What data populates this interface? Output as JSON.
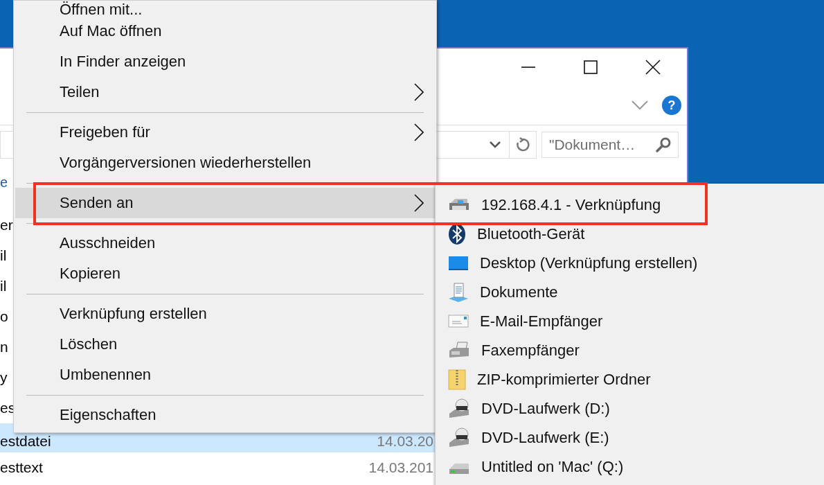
{
  "explorer_window": {
    "help_button": {
      "label": "?"
    },
    "search": {
      "placeholder": "\"Dokument…"
    },
    "nav_items": [
      {
        "label": "e"
      }
    ],
    "files": [
      {
        "name": "er",
        "selected": false
      },
      {
        "name": "il",
        "selected": false
      },
      {
        "name": "il",
        "selected": false
      },
      {
        "name": "o",
        "selected": false
      },
      {
        "name": "n",
        "selected": false
      },
      {
        "name": "y",
        "selected": false
      },
      {
        "name": "es",
        "selected": false
      },
      {
        "name": "estdatei",
        "date": "14.03.20",
        "selected": true
      },
      {
        "name": "esttext",
        "date": "14.03.201",
        "selected": false
      }
    ]
  },
  "context_menu": {
    "items": [
      {
        "kind": "item",
        "label": "Öffnen mit...",
        "has_submenu": false,
        "selected": false
      },
      {
        "kind": "item",
        "label": "Auf Mac öffnen",
        "has_submenu": false,
        "selected": false
      },
      {
        "kind": "item",
        "label": "In Finder anzeigen",
        "has_submenu": false,
        "selected": false
      },
      {
        "kind": "item",
        "label": "Teilen",
        "has_submenu": true,
        "selected": false
      },
      {
        "kind": "separator"
      },
      {
        "kind": "item",
        "label": "Freigeben für",
        "has_submenu": true,
        "selected": false
      },
      {
        "kind": "item",
        "label": "Vorgängerversionen wiederherstellen",
        "has_submenu": false,
        "selected": false
      },
      {
        "kind": "separator"
      },
      {
        "kind": "item",
        "label": "Senden an",
        "has_submenu": true,
        "selected": true
      },
      {
        "kind": "separator"
      },
      {
        "kind": "item",
        "label": "Ausschneiden",
        "has_submenu": false,
        "selected": false
      },
      {
        "kind": "item",
        "label": "Kopieren",
        "has_submenu": false,
        "selected": false
      },
      {
        "kind": "separator"
      },
      {
        "kind": "item",
        "label": "Verknüpfung erstellen",
        "has_submenu": false,
        "selected": false
      },
      {
        "kind": "item",
        "label": "Löschen",
        "has_submenu": false,
        "selected": false
      },
      {
        "kind": "item",
        "label": "Umbenennen",
        "has_submenu": false,
        "selected": false
      },
      {
        "kind": "separator"
      },
      {
        "kind": "item",
        "label": "Eigenschaften",
        "has_submenu": false,
        "selected": false
      }
    ]
  },
  "send_to_menu": {
    "items": [
      {
        "kind": "network-printer",
        "label": "192.168.4.1 - Verknüpfung",
        "selected": false
      },
      {
        "kind": "bluetooth",
        "label": "Bluetooth-Gerät",
        "selected": false
      },
      {
        "kind": "desktop",
        "label": "Desktop (Verknüpfung erstellen)",
        "selected": false
      },
      {
        "kind": "documents",
        "label": "Dokumente",
        "selected": false
      },
      {
        "kind": "mail",
        "label": "E-Mail-Empfänger",
        "selected": false
      },
      {
        "kind": "fax",
        "label": "Faxempfänger",
        "selected": false
      },
      {
        "kind": "zip",
        "label": "ZIP-komprimierter Ordner",
        "selected": false
      },
      {
        "kind": "dvd",
        "label": "DVD-Laufwerk (D:)",
        "selected": false
      },
      {
        "kind": "dvd",
        "label": "DVD-Laufwerk (E:)",
        "selected": false
      },
      {
        "kind": "network-drive",
        "label": "Untitled on 'Mac' (Q:)",
        "selected": false
      }
    ]
  }
}
